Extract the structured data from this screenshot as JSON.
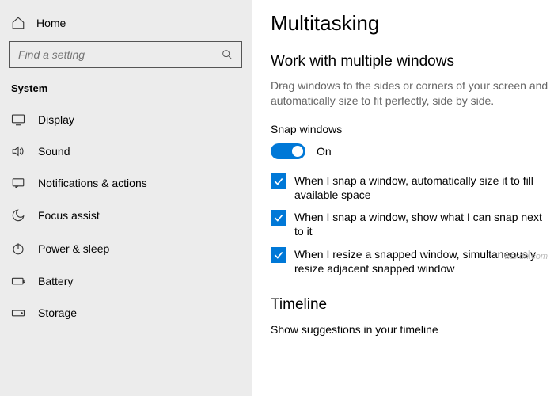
{
  "sidebar": {
    "home": "Home",
    "search_placeholder": "Find a setting",
    "section": "System",
    "items": [
      {
        "label": "Display"
      },
      {
        "label": "Sound"
      },
      {
        "label": "Notifications & actions"
      },
      {
        "label": "Focus assist"
      },
      {
        "label": "Power & sleep"
      },
      {
        "label": "Battery"
      },
      {
        "label": "Storage"
      }
    ]
  },
  "content": {
    "title": "Multitasking",
    "section1_title": "Work with multiple windows",
    "section1_desc": "Drag windows to the sides or corners of your screen and automatically size to fit perfectly, side by side.",
    "snap_label": "Snap windows",
    "toggle_text": "On",
    "checks": [
      "When I snap a window, automatically size it to fill available space",
      "When I snap a window, show what I can snap next to it",
      "When I resize a snapped window, simultaneously resize adjacent snapped window"
    ],
    "section2_title": "Timeline",
    "section2_sub": "Show suggestions in your timeline"
  },
  "watermark": "wsxdn.com"
}
